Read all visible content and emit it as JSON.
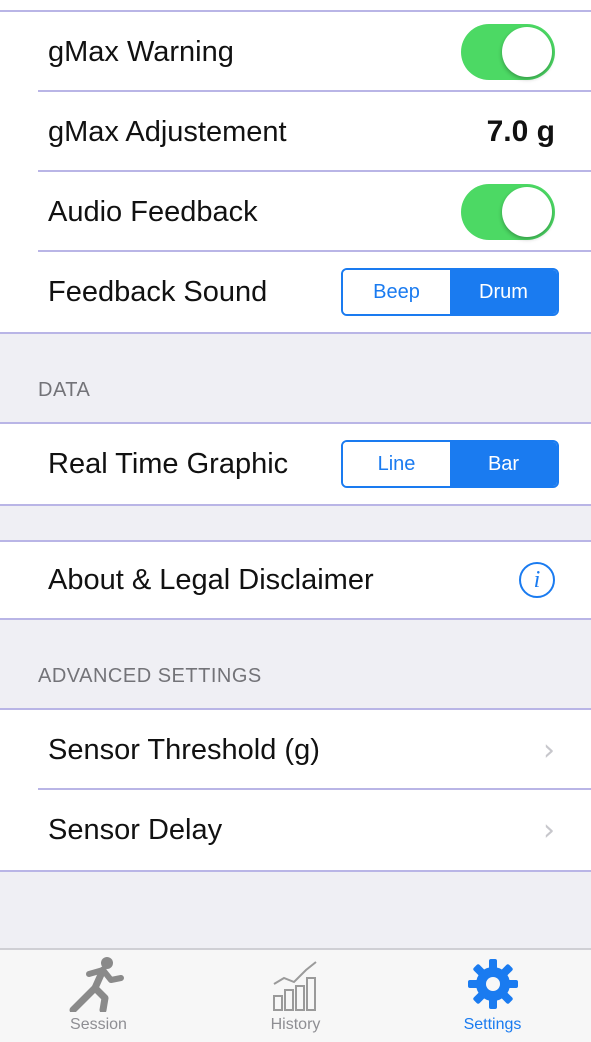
{
  "settings": {
    "gmax_warning": {
      "label": "gMax Warning",
      "on": true
    },
    "gmax_adjustment": {
      "label": "gMax Adjustement",
      "value": "7.0 g"
    },
    "audio_feedback": {
      "label": "Audio Feedback",
      "on": true
    },
    "feedback_sound": {
      "label": "Feedback Sound",
      "options": [
        "Beep",
        "Drum"
      ],
      "selected": "Drum"
    }
  },
  "data_section": {
    "header": "DATA",
    "real_time_graphic": {
      "label": "Real Time Graphic",
      "options": [
        "Line",
        "Bar"
      ],
      "selected": "Bar"
    }
  },
  "about": {
    "label": "About & Legal Disclaimer",
    "icon": "info-icon"
  },
  "advanced": {
    "header": "ADVANCED SETTINGS",
    "items": [
      {
        "label": "Sensor Threshold (g)"
      },
      {
        "label": "Sensor Delay"
      }
    ]
  },
  "tabbar": {
    "tabs": [
      {
        "label": "Session",
        "icon": "runner-icon",
        "active": false
      },
      {
        "label": "History",
        "icon": "chart-icon",
        "active": false
      },
      {
        "label": "Settings",
        "icon": "gear-icon",
        "active": true
      }
    ]
  },
  "colors": {
    "accent": "#1a7bf0",
    "toggle_on": "#4cd964",
    "separator": "#b9b5e6",
    "background": "#efeff4"
  }
}
